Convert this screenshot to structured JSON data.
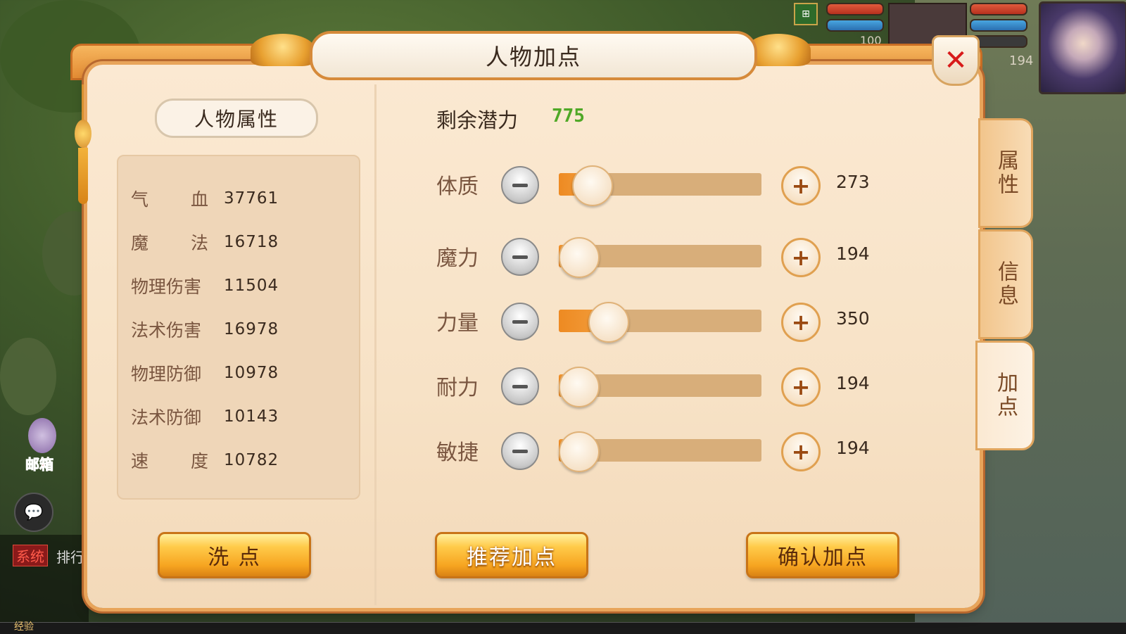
{
  "dialog": {
    "title": "人物加点",
    "close_symbol": "✕"
  },
  "hud": {
    "pet_level": "100",
    "player_level": "194",
    "mail_label": "邮箱",
    "chat_tag": "系统",
    "chat_text": "排行",
    "exp_label": "经验",
    "map_icon": "map-icon",
    "chat_icon": "chat-bubble-icon"
  },
  "left_panel": {
    "title": "人物属性",
    "attributes": [
      {
        "name_a": "气",
        "name_b": "血",
        "value": "37761"
      },
      {
        "name_a": "魔",
        "name_b": "法",
        "value": "16718"
      },
      {
        "name": "物理伤害",
        "value": "11504"
      },
      {
        "name": "法术伤害",
        "value": "16978"
      },
      {
        "name": "物理防御",
        "value": "10978"
      },
      {
        "name": "法术防御",
        "value": "10143"
      },
      {
        "name_a": "速",
        "name_b": "度",
        "value": "10782"
      }
    ],
    "reset_button": "洗 点"
  },
  "right_panel": {
    "potential_label": "剩余潜力",
    "potential_value": "775",
    "stats": [
      {
        "name": "体质",
        "value": "273",
        "level": 0.16
      },
      {
        "name": "魔力",
        "value": "194",
        "level": 0.0
      },
      {
        "name": "力量",
        "value": "350",
        "level": 0.24
      },
      {
        "name": "耐力",
        "value": "194",
        "level": 0.0
      },
      {
        "name": "敏捷",
        "value": "194",
        "level": 0.0
      }
    ],
    "recommend_button": "推荐加点",
    "confirm_button": "确认加点"
  },
  "side_tabs": [
    {
      "label": "属性"
    },
    {
      "label": "信息"
    },
    {
      "label": "加点",
      "active": true
    }
  ],
  "colors": {
    "accent": "#f6a420",
    "potential": "#4fa826",
    "close": "#d81a1a"
  }
}
